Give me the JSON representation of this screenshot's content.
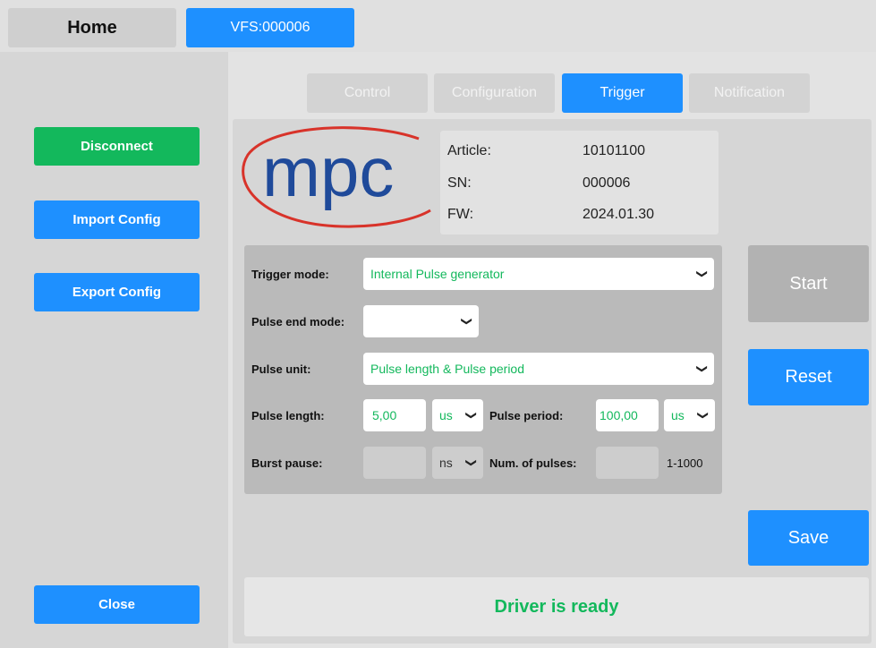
{
  "header": {
    "home_label": "Home",
    "device_tab_label": "VFS:000006"
  },
  "sidebar": {
    "disconnect_label": "Disconnect",
    "import_label": "Import Config",
    "export_label": "Export Config",
    "close_label": "Close"
  },
  "tabs": [
    {
      "label": "Control",
      "active": false
    },
    {
      "label": "Configuration",
      "active": false
    },
    {
      "label": "Trigger",
      "active": true
    },
    {
      "label": "Notification",
      "active": false
    }
  ],
  "logo": {
    "text": "mpc"
  },
  "device_info": {
    "article_label": "Article:",
    "article_value": "10101100",
    "sn_label": "SN:",
    "sn_value": "000006",
    "fw_label": "FW:",
    "fw_value": "2024.01.30"
  },
  "form": {
    "trigger_mode_label": "Trigger mode:",
    "trigger_mode_value": "Internal Pulse generator",
    "pulse_end_mode_label": "Pulse end mode:",
    "pulse_end_mode_value": "",
    "pulse_unit_label": "Pulse unit:",
    "pulse_unit_value": "Pulse length & Pulse period",
    "pulse_length_label": "Pulse length:",
    "pulse_length_value": "5,00",
    "pulse_length_unit": "us",
    "pulse_period_label": "Pulse period:",
    "pulse_period_value": "100,00",
    "pulse_period_unit": "us",
    "burst_pause_label": "Burst pause:",
    "burst_pause_value": "",
    "burst_pause_unit": "ns",
    "num_pulses_label": "Num. of pulses:",
    "num_pulses_value": "",
    "num_pulses_range": "1-1000"
  },
  "actions": {
    "start_label": "Start",
    "reset_label": "Reset",
    "save_label": "Save"
  },
  "status": {
    "text": "Driver is ready"
  },
  "colors": {
    "accent": "#1e90ff",
    "success": "#13b85c",
    "logo_red": "#d8332a",
    "logo_blue": "#1f4a9a"
  },
  "icons": {
    "dropdown": "chevron-down-icon"
  }
}
